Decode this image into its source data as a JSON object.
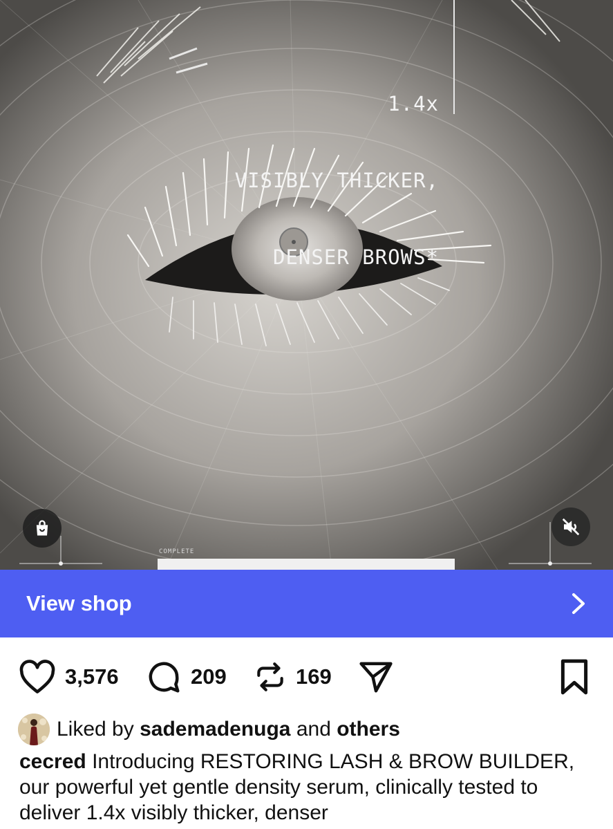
{
  "media": {
    "overlay_lines": [
      "1.4x",
      "VISIBLY THICKER,",
      "DENSER BROWS*"
    ],
    "complete_label": "COMPLETE",
    "progress": 1.0,
    "shop_bag_icon": "shopping-bag-icon",
    "mute_icon": "speaker-muted-icon"
  },
  "shop_bar": {
    "label": "View shop",
    "chevron_icon": "chevron-right-icon",
    "color": "#4e5ef2"
  },
  "actions": {
    "likes": "3,576",
    "comments": "209",
    "reposts": "169"
  },
  "liked_by": {
    "prefix": "Liked by ",
    "user": "sademadenuga",
    "middle": " and ",
    "suffix": "others"
  },
  "caption": {
    "username": "cecred",
    "text": " Introducing RESTORING LASH & BROW BUILDER, our powerful yet gentle density serum, clinically tested to deliver 1.4x visibly thicker, denser"
  }
}
